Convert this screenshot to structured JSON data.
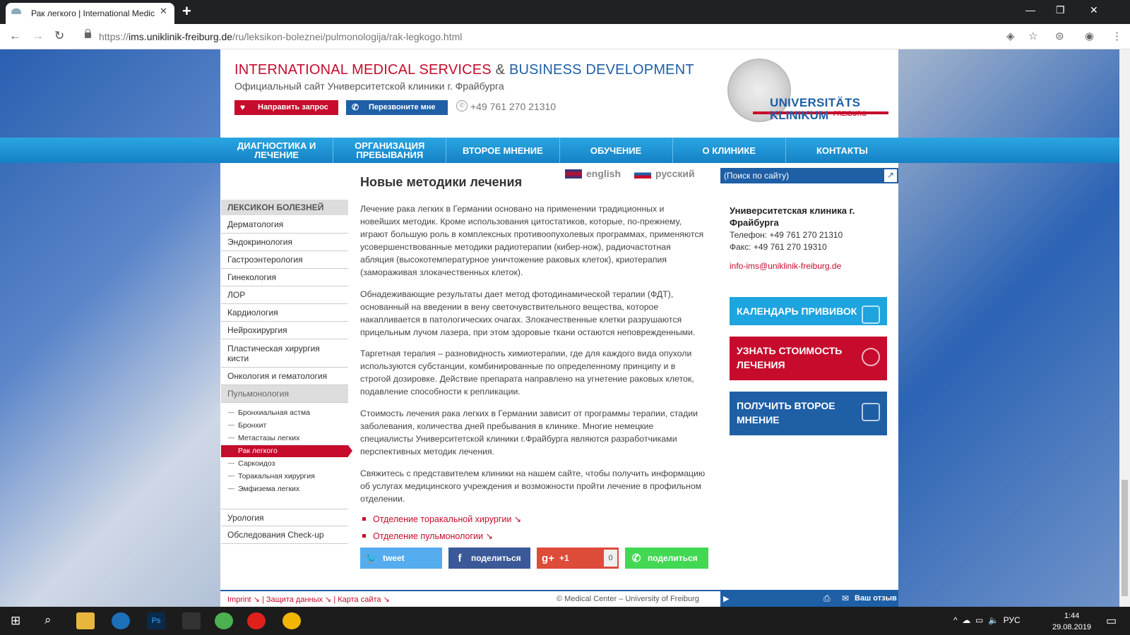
{
  "browser": {
    "tab_title": "Рак легкого | International Medic",
    "url_prefix": "https://",
    "url_domain": "ims.uniklinik-freiburg.de",
    "url_path": "/ru/leksikon-boleznei/pulmonologija/rak-legkogo.html"
  },
  "header": {
    "title_red": "INTERNATIONAL MEDICAL SERVICES",
    "title_amp": "&",
    "title_blue": "BUSINESS DEVELOPMENT",
    "subtitle": "Официальный сайт Университетской клиники г. Фрайбурга",
    "request_button": "Направить запрос",
    "callback_button": "Перезвоните мне",
    "phone": "+49 761 270 21310",
    "logo_line1": "UNIVERSITÄTS",
    "logo_line2": "KLINIKUM",
    "logo_freiburg": "FREIBURG"
  },
  "nav": [
    "ДИАГНОСТИКА И ЛЕЧЕНИЕ",
    "ОРГАНИЗАЦИЯ ПРЕБЫВАНИЯ",
    "ВТОРОЕ МНЕНИЕ",
    "ОБУЧЕНИЕ",
    "О КЛИНИКЕ",
    "КОНТАКТЫ"
  ],
  "languages": {
    "en": "english",
    "ru": "русский"
  },
  "search": {
    "placeholder": "(Поиск по сайту)"
  },
  "sidebar": {
    "heading": "ЛЕКСИКОН БОЛЕЗНЕЙ",
    "items": [
      "Дерматология",
      "Эндокринология",
      "Гастроэнтерология",
      "Гинекология",
      "ЛОР",
      "Кардиология",
      "Нейрохирургия",
      "Пластическая хирургия кисти",
      "Онкология и гематология",
      "Пульмонология"
    ],
    "subitems": [
      "Бронхиальная астма",
      "Бронхит",
      "Метастазы легких",
      "Рак легкого",
      "Саркоидоз",
      "Торакальная хирургия",
      "Эмфизема легких"
    ],
    "bottom_items": [
      "Урология",
      "Обследования Check-up"
    ]
  },
  "content": {
    "title": "Новые методики лечения",
    "paragraphs": [
      "Лечение рака легких в Германии основано на применении традиционных и новейших методик. Кроме использования цитостатиков, которые, по-прежнему, играют большую роль в комплексных противоопухолевых программах, применяются усовершенствованные методики радиотерапии (кибер-нож), радиочастотная абляция (высокотемпературное уничтожение раковых клеток), криотерапия (замораживая злокачественных клеток).",
      "Обнадеживающие результаты дает метод фотодинамической терапии (ФДТ), основанный на введении в вену светочувствительного вещества, которое накапливается в патологических очагах. Злокачественные клетки разрушаются прицельным лучом лазера, при этом здоровые ткани остаются неповрежденными.",
      "Таргетная терапия – разновидность химиотерапии, где для каждого вида опухоли используются субстанции, комбинированные по определенному принципу и в строгой дозировке. Действие препарата направлено на угнетение раковых клеток, подавление способности к репликации.",
      "Стоимость лечения рака легких в Германии зависит от программы терапии, стадии заболевания, количества дней пребывания в клинике. Многие немецкие специалисты Университетской клиники г.Фрайбурга являются разработчиками перспективных методик лечения.",
      "Свяжитесь с представителем клиники на нашем сайте, чтобы получить информацию об услугах медицинского учреждения и возможности пройти лечение в профильном отделении."
    ],
    "links": [
      "Отделение торакальной хирургии ↘",
      "Отделение пульмонологии ↘"
    ]
  },
  "share": {
    "twitter": "tweet",
    "facebook": "поделиться",
    "gplus": "+1",
    "gplus_count": "0",
    "whatsapp": "поделиться"
  },
  "contact": {
    "name": "Университетская клиника г. Фрайбурга",
    "phone": "Телефон: +49 761 270 21310",
    "fax": "Факс: +49 761 270 19310",
    "email": "info-ims@uniklinik-freiburg.de"
  },
  "banners": [
    "КАЛЕНДАРЬ ПРИВИВОК",
    "УЗНАТЬ СТОИМОСТЬ ЛЕЧЕНИЯ",
    "ПОЛУЧИТЬ ВТОРОЕ МНЕНИЕ"
  ],
  "footer": {
    "links": "Imprint ↘ | Защита данных ↘ | Карта сайта ↘",
    "copyright": "© Medical Center – University of Freiburg",
    "feedback": "Ваш отзыв"
  },
  "taskbar": {
    "lang": "РУС",
    "time": "1:44",
    "date": "29.08.2019"
  }
}
